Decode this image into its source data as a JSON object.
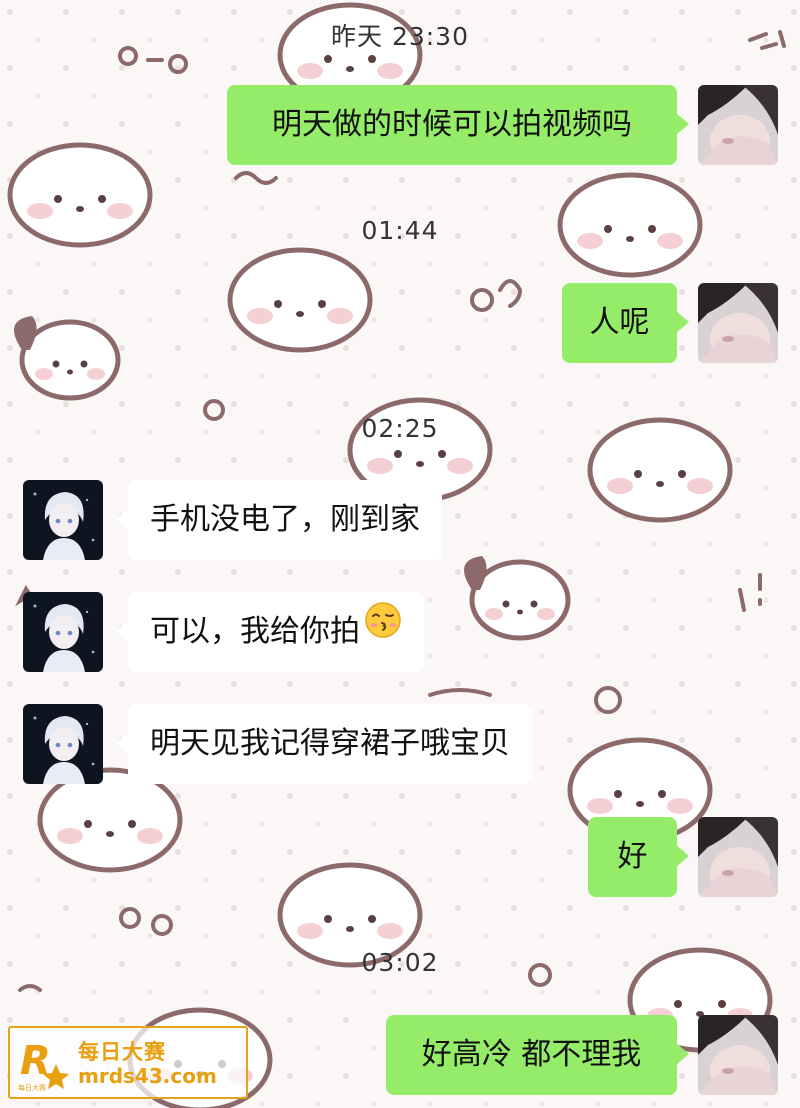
{
  "messages": [
    {
      "type": "time",
      "text": "昨天 23:30"
    },
    {
      "type": "out",
      "text": "明天做的时候可以拍视频吗"
    },
    {
      "type": "time",
      "text": "01:44"
    },
    {
      "type": "out",
      "text": "人呢"
    },
    {
      "type": "time",
      "text": "02:25"
    },
    {
      "type": "in",
      "text": "手机没电了，刚到家"
    },
    {
      "type": "in",
      "text": "可以，我给你拍",
      "emoji": "kissing-face-emoji"
    },
    {
      "type": "in",
      "text": "明天见我记得穿裙子哦宝贝"
    },
    {
      "type": "out",
      "text": "好"
    },
    {
      "type": "time",
      "text": "03:02"
    },
    {
      "type": "out",
      "text": "好高冷 都不理我"
    }
  ],
  "watermark": {
    "logo_letter": "R",
    "logo_small": "每日大赛",
    "title": "每日大赛",
    "url": "mrds43.com"
  },
  "colors": {
    "outgoing_bubble": "#95ec69",
    "incoming_bubble": "#ffffff",
    "wallpaper_bg": "#fbf7f7",
    "watermark_accent": "#e6a21a"
  }
}
